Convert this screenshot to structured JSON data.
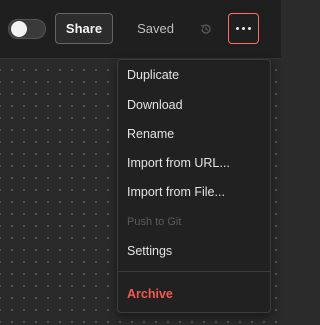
{
  "toolbar": {
    "share_label": "Share",
    "saved_label": "Saved",
    "active_toggle": false
  },
  "menu": {
    "items": [
      {
        "label": "Duplicate",
        "state": "enabled"
      },
      {
        "label": "Download",
        "state": "enabled"
      },
      {
        "label": "Rename",
        "state": "enabled"
      },
      {
        "label": "Import from URL...",
        "state": "enabled"
      },
      {
        "label": "Import from File...",
        "state": "enabled"
      },
      {
        "label": "Push to Git",
        "state": "disabled"
      },
      {
        "label": "Settings",
        "state": "enabled"
      },
      {
        "label": "Archive",
        "state": "danger"
      }
    ]
  },
  "colors": {
    "accent": "#ff6d5a",
    "danger": "#f15b4e",
    "background": "#2b2b2b",
    "menu_background": "#212121"
  },
  "icons": {
    "history": "history-icon",
    "more": "more-horizontal-icon"
  }
}
